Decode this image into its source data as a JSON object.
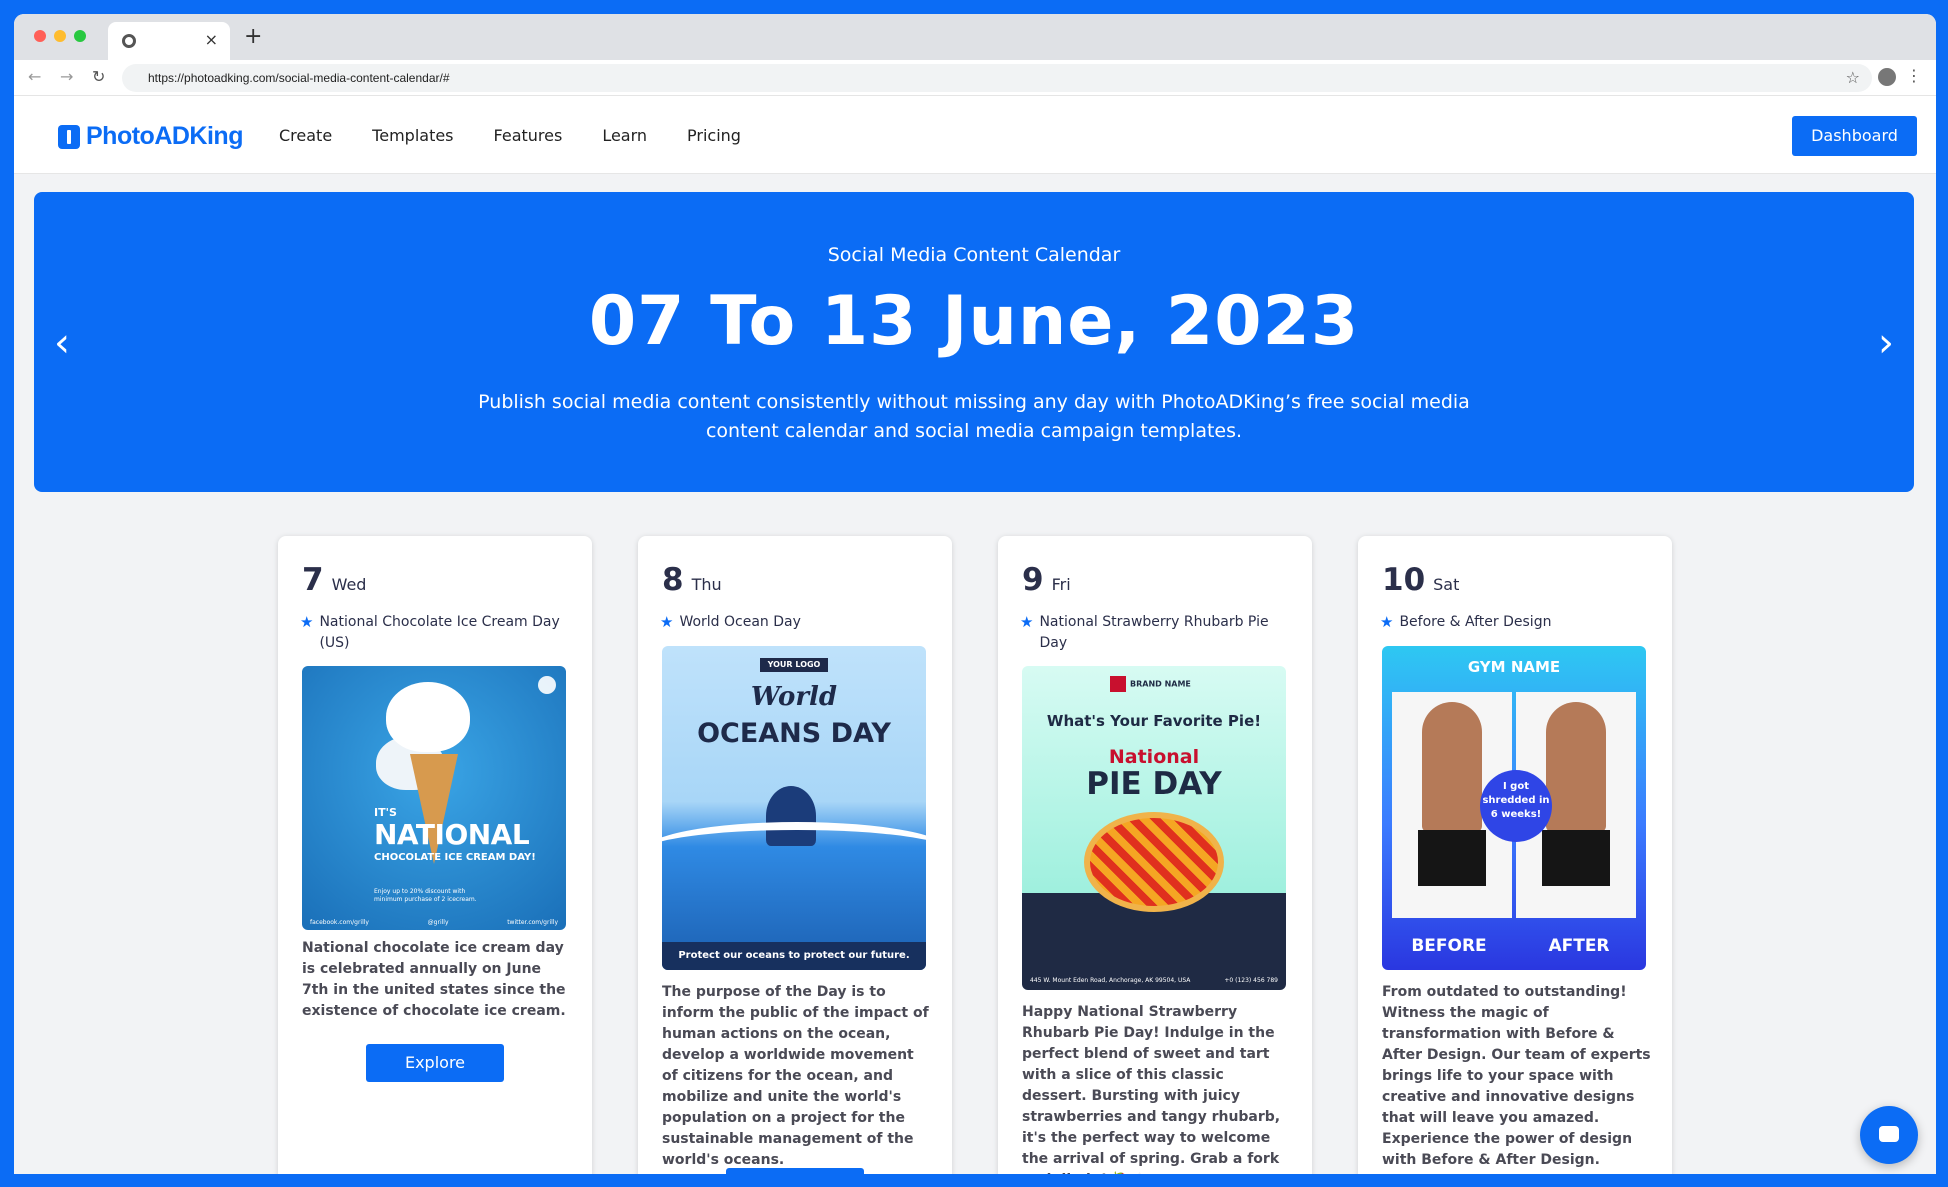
{
  "browser": {
    "tab_close": "×",
    "new_tab": "+",
    "url": "https://photoadking.com/social-media-content-calendar/#"
  },
  "site": {
    "logo": "PhotoADKing",
    "nav": [
      "Create",
      "Templates",
      "Features",
      "Learn",
      "Pricing"
    ],
    "dashboard": "Dashboard"
  },
  "hero": {
    "kicker": "Social Media Content Calendar",
    "title": "07 To 13 June, 2023",
    "desc": "Publish social media content consistently without missing any day with PhotoADKing’s free social media content calendar and social media campaign templates.",
    "prev_icon": "chevron-left-icon",
    "next_icon": "chevron-right-icon"
  },
  "cards": [
    {
      "day": "7",
      "dow": "Wed",
      "event": "National Chocolate Ice Cream Day (US)",
      "text": "National chocolate ice cream day is celebrated annually on June 7th in the united states since the existence of chocolate ice cream.",
      "button": "Explore",
      "img": {
        "its": "IT'S",
        "national": "NATIONAL",
        "sub": "CHOCOLATE ICE CREAM DAY!",
        "small": "Enjoy up to 20% discount with minimum purchase of 2 icecream.",
        "foot": [
          "facebook.com/grilly",
          "@grilly",
          "twitter.com/grilly"
        ]
      }
    },
    {
      "day": "8",
      "dow": "Thu",
      "event": "World Ocean Day",
      "text": "The purpose of the Day is to inform the public of the impact of human actions on the ocean, develop a worldwide movement of citizens for the ocean, and mobilize and unite the world's population on a project for the sustainable management of the world's oceans.",
      "img": {
        "logo": "YOUR LOGO",
        "world": "World",
        "day": "OCEANS DAY",
        "bar": "Protect our oceans to protect our future."
      }
    },
    {
      "day": "9",
      "dow": "Fri",
      "event": "National Strawberry Rhubarb Pie Day",
      "text": "Happy National Strawberry Rhubarb Pie Day! Indulge in the perfect blend of sweet and tart with a slice of this classic dessert. Bursting with juicy strawberries and tangy rhubarb, it's the perfect way to welcome the arrival of spring. Grab a fork and dig in! 🍓🥧",
      "img": {
        "brand": "BRAND NAME",
        "question": "What's Your Favorite Pie!",
        "national": "National",
        "day": "PIE DAY",
        "address": "445 W. Mount Eden Road, Anchorage, AK 99504, USA",
        "phone": "+0 (123) 456 789"
      }
    },
    {
      "day": "10",
      "dow": "Sat",
      "event": "Before & After Design",
      "text": "From outdated to outstanding! Witness the magic of transformation with Before & After Design. Our team of experts brings life to your space with creative and innovative designs that will leave you amazed. Experience the power of design with Before & After Design.",
      "img": {
        "gym": "GYM NAME",
        "badge": "I got shredded in 6 weeks!",
        "before": "BEFORE",
        "after": "AFTER"
      }
    }
  ]
}
